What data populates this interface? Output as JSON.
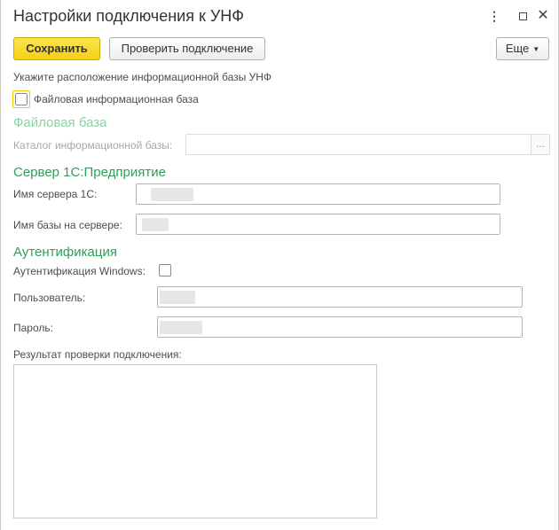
{
  "window": {
    "title": "Настройки подключения к УНФ",
    "more_icon": "⋮",
    "maximize_icon": "square",
    "close_icon": "✕"
  },
  "toolbar": {
    "save_label": "Сохранить",
    "check_label": "Проверить подключение",
    "more_label": "Еще",
    "more_arrow": "▼"
  },
  "location": {
    "prompt": "Укажите расположение информационной базы УНФ",
    "file_db_checkbox_label": "Файловая информационная база",
    "file_db_checked": false
  },
  "file_base": {
    "section_title": "Файловая база",
    "catalog_label": "Каталог информационной базы:",
    "catalog_value": "",
    "browse_label": "..."
  },
  "server": {
    "section_title": "Сервер 1С:Предприятие",
    "server_name_label": "Имя сервера 1С:",
    "db_name_label": "Имя базы на сервере:"
  },
  "auth": {
    "section_title": "Аутентификация",
    "windows_auth_label": "Аутентификация Windows:",
    "windows_auth_checked": false,
    "user_label": "Пользователь:",
    "password_label": "Пароль:"
  },
  "result": {
    "label": "Результат проверки подключения:",
    "value": ""
  },
  "colors": {
    "save_button": "#f5cf17",
    "section_title": "#2f9e58",
    "section_title_disabled": "#8fd0a6",
    "focus_border": "#f0c800"
  }
}
